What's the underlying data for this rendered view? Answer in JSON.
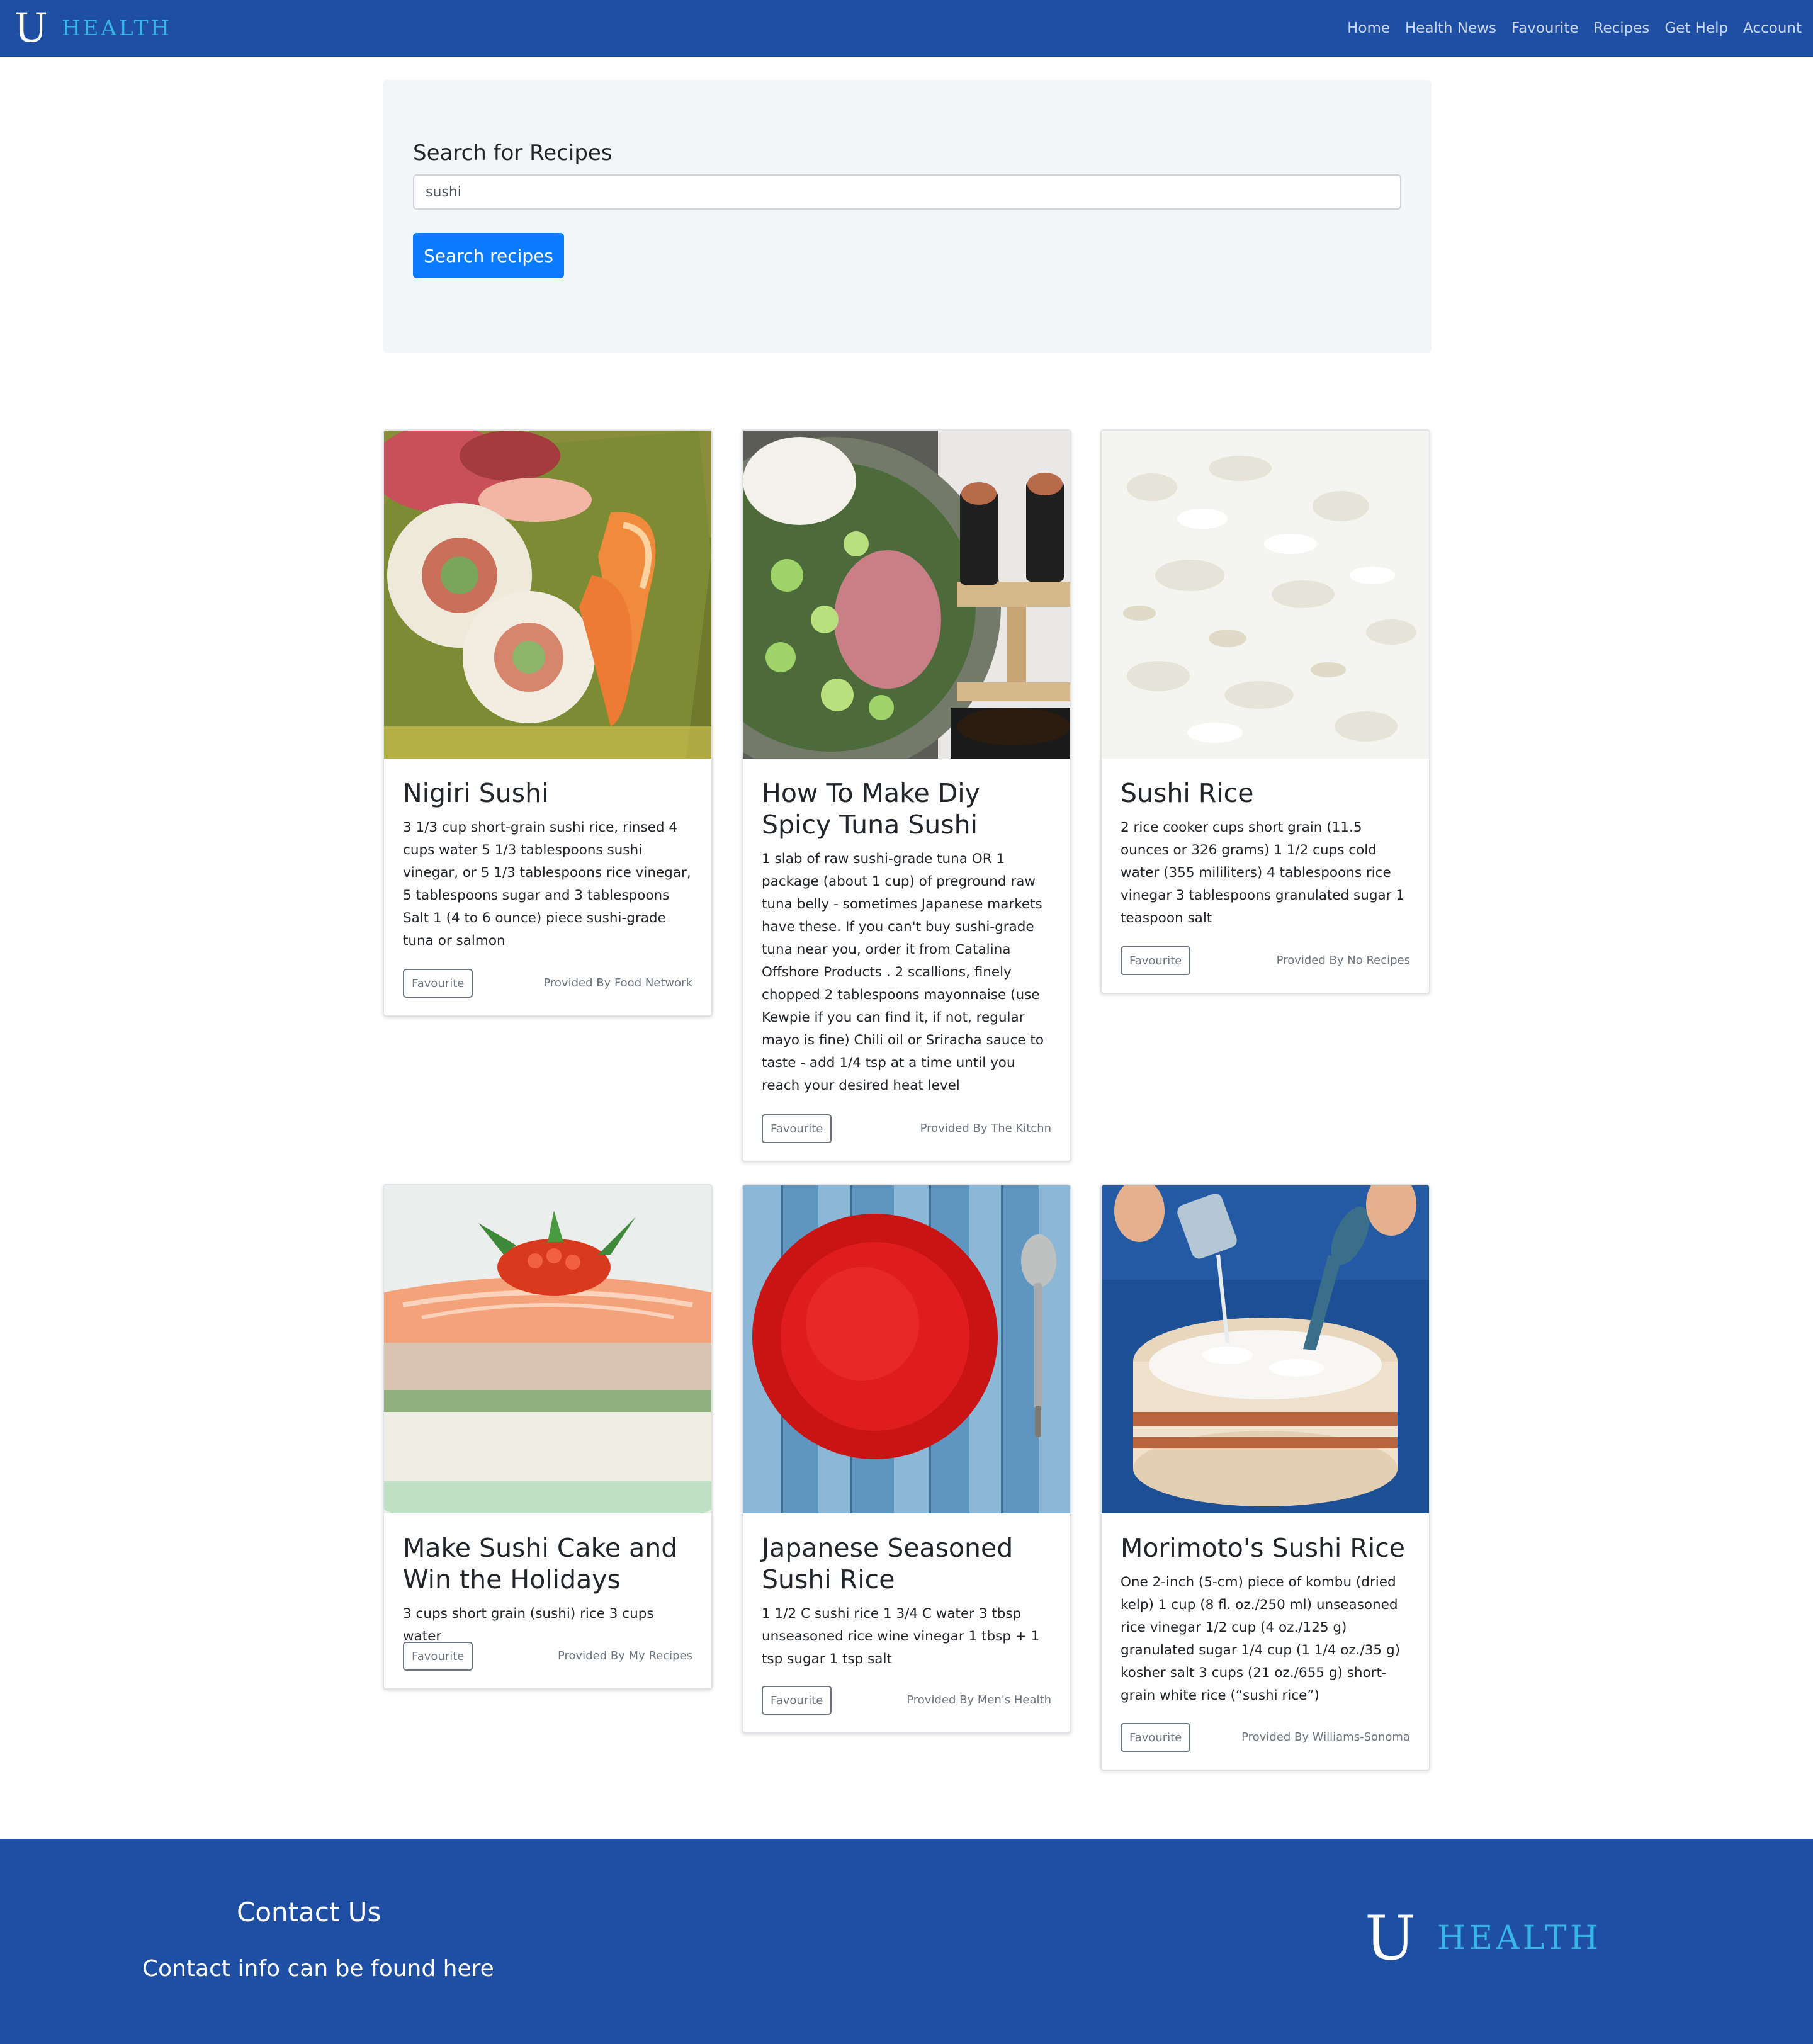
{
  "brand": {
    "letter": "U",
    "name": "HEALTH"
  },
  "nav": {
    "items": [
      "Home",
      "Health News",
      "Favourite",
      "Recipes",
      "Get Help",
      "Account"
    ]
  },
  "search": {
    "label": "Search for Recipes",
    "value": "sushi",
    "button_label": "Search recipes"
  },
  "recipes": [
    {
      "title": "Nigiri Sushi",
      "ingredients": "3 1/3 cup short-grain sushi rice, rinsed 4 cups water 5 1/3 tablespoons sushi vinegar, or 5 1/3 tablespoons rice vinegar, 5 tablespoons sugar and 3 tablespoons Salt 1 (4 to 6 ounce) piece sushi-grade tuna or salmon",
      "favourite_label": "Favourite",
      "provider": "Provided By Food Network",
      "image": "sushi-roll-and-shrimp-nigiri-photo"
    },
    {
      "title": "How To Make Diy Spicy Tuna Sushi",
      "ingredients": "1 slab of raw sushi-grade tuna OR 1 package (about 1 cup) of preground raw tuna belly - sometimes Japanese markets have these. If you can't buy sushi-grade tuna near you, order it from Catalina Offshore Products . 2 scallions, finely chopped 2 tablespoons mayonnaise (use Kewpie if you can find it, if not, regular mayo is fine) Chili oil or Sriracha sauce to taste - add 1/4 tsp at a time until you reach your desired heat level",
      "favourite_label": "Favourite",
      "provider": "Provided By The Kitchn",
      "image": "spicy-tuna-bowl-and-hand-rolls-photo"
    },
    {
      "title": "Sushi Rice",
      "ingredients": "2 rice cooker cups short grain (11.5 ounces or 326 grams) 1 1/2 cups cold water (355 mililiters) 4 tablespoons rice vinegar 3 tablespoons granulated sugar 1 teaspoon salt",
      "favourite_label": "Favourite",
      "provider": "Provided By No Recipes",
      "image": "white-rice-closeup-photo"
    },
    {
      "title": "Make Sushi Cake and Win the Holidays",
      "ingredients": "3 cups short grain (sushi) rice 3 cups water",
      "favourite_label": "Favourite",
      "provider": "Provided By My Recipes",
      "image": "salmon-sushi-cake-photo"
    },
    {
      "title": "Japanese Seasoned Sushi Rice",
      "ingredients": "1 1/2 C sushi rice 1 3/4 C water 3 tbsp unseasoned rice wine vinegar 1 tbsp + 1 tsp sugar 1 tsp salt",
      "favourite_label": "Favourite",
      "provider": "Provided By Men's Health",
      "image": "red-plate-on-blue-wood-photo"
    },
    {
      "title": "Morimoto's Sushi Rice",
      "ingredients": "One 2-inch (5-cm) piece of kombu (dried kelp) 1 cup (8 fl. oz./250 ml) unseasoned rice vinegar 1/2 cup (4 oz./125 g) granulated sugar 1/4 cup (1 1/4 oz./35 g) kosher salt 3 cups (21 oz./655 g) short-grain white rice (“sushi rice”)",
      "favourite_label": "Favourite",
      "provider": "Provided By Williams-Sonoma",
      "image": "pouring-vinegar-on-rice-tub-photo"
    }
  ],
  "footer": {
    "heading": "Contact Us",
    "text": "Contact info can be found here"
  },
  "colors": {
    "navbar": "#1f4fa3",
    "brand_accent": "#38b6e8",
    "primary_button": "#0a7bff",
    "jumbotron": "#f4f5f7"
  }
}
